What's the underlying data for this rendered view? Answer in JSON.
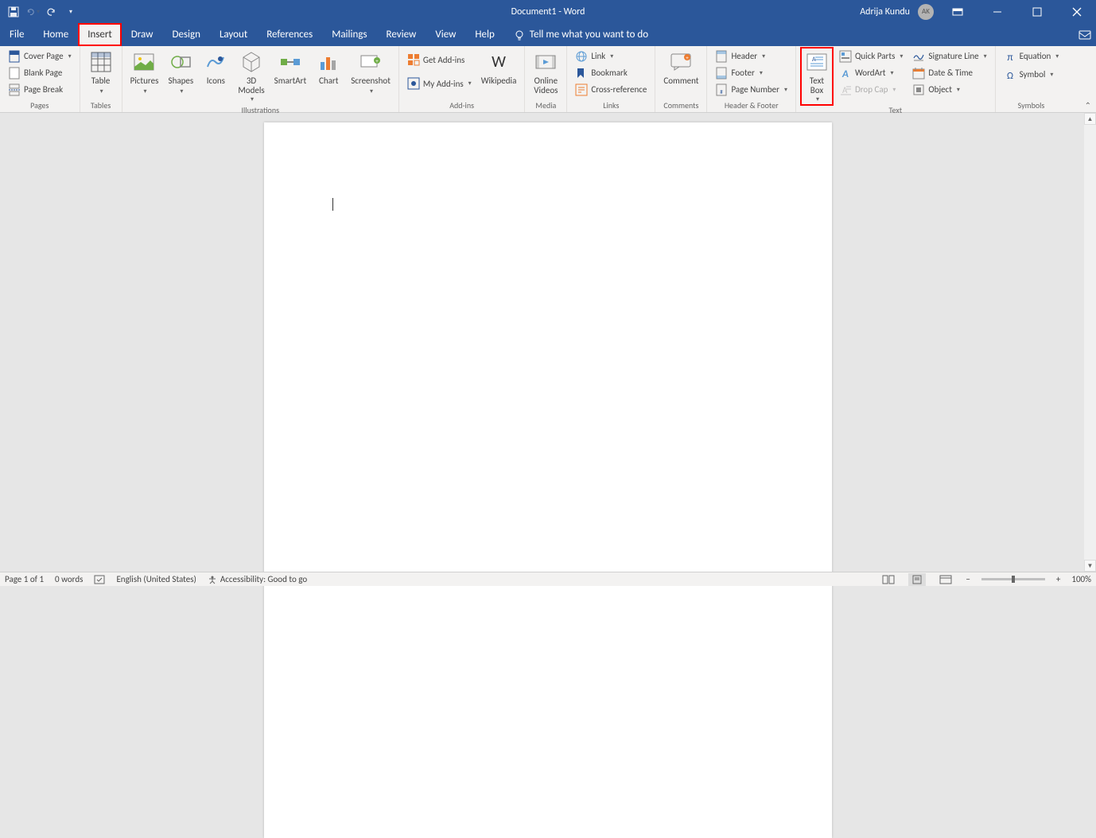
{
  "title": "Document1  -  Word",
  "user": {
    "name": "Adrija Kundu",
    "initials": "AK"
  },
  "qat": {
    "save": "Save",
    "undo": "Undo",
    "redo": "Redo"
  },
  "tabs": [
    "File",
    "Home",
    "Insert",
    "Draw",
    "Design",
    "Layout",
    "References",
    "Mailings",
    "Review",
    "View",
    "Help"
  ],
  "tell_me": "Tell me what you want to do",
  "groups": {
    "pages": {
      "label": "Pages",
      "cover": "Cover Page",
      "blank": "Blank Page",
      "break": "Page Break"
    },
    "tables": {
      "label": "Tables",
      "table": "Table"
    },
    "illustrations": {
      "label": "Illustrations",
      "pictures": "Pictures",
      "shapes": "Shapes",
      "icons": "Icons",
      "models": "3D\nModels",
      "smartart": "SmartArt",
      "chart": "Chart",
      "screenshot": "Screenshot"
    },
    "addins": {
      "label": "Add-ins",
      "get": "Get Add-ins",
      "my": "My Add-ins",
      "wikipedia": "Wikipedia"
    },
    "media": {
      "label": "Media",
      "videos": "Online\nVideos"
    },
    "links": {
      "label": "Links",
      "link": "Link",
      "bookmark": "Bookmark",
      "cross": "Cross-reference"
    },
    "comments": {
      "label": "Comments",
      "comment": "Comment"
    },
    "headerfooter": {
      "label": "Header & Footer",
      "header": "Header",
      "footer": "Footer",
      "pagenum": "Page Number"
    },
    "text": {
      "label": "Text",
      "textbox": "Text\nBox",
      "quickparts": "Quick Parts",
      "wordart": "WordArt",
      "dropcap": "Drop Cap",
      "sigline": "Signature Line",
      "datetime": "Date & Time",
      "object": "Object"
    },
    "symbols": {
      "label": "Symbols",
      "equation": "Equation",
      "symbol": "Symbol"
    }
  },
  "status": {
    "page": "Page 1 of 1",
    "words": "0 words",
    "lang": "English (United States)",
    "access": "Accessibility: Good to go",
    "zoom": "100%"
  }
}
